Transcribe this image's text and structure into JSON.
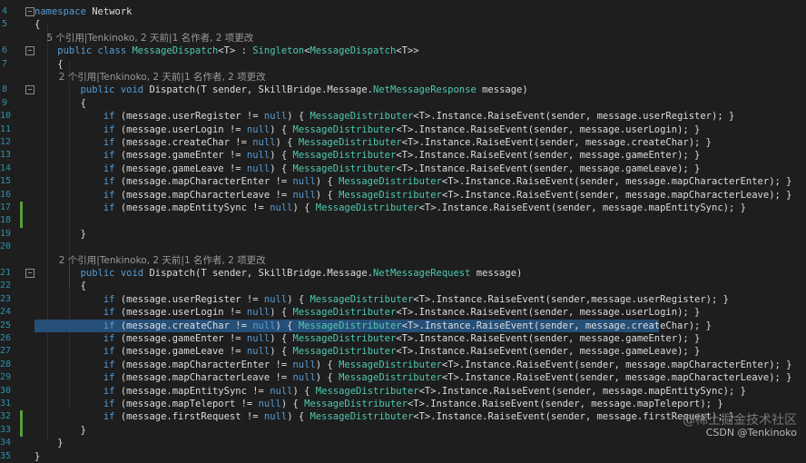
{
  "code": {
    "lines": [
      {
        "n": "4",
        "fold": "−",
        "parts": [
          {
            "c": "kw",
            "t": "namespace"
          },
          {
            "c": "pl",
            "t": " Network"
          }
        ]
      },
      {
        "n": "5",
        "parts": [
          {
            "c": "pl",
            "t": "{"
          }
        ]
      },
      {
        "n": "",
        "lens": true,
        "parts": [
          {
            "c": "lens",
            "t": "    5 个引用|Tenkinoko, 2 天前|1 名作者, 2 项更改"
          }
        ]
      },
      {
        "n": "6",
        "fold": "−",
        "parts": [
          {
            "c": "kw",
            "t": "    public class "
          },
          {
            "c": "ty",
            "t": "MessageDispatch"
          },
          {
            "c": "pl",
            "t": "<T> : "
          },
          {
            "c": "ty",
            "t": "Singleton"
          },
          {
            "c": "pl",
            "t": "<"
          },
          {
            "c": "ty",
            "t": "MessageDispatch"
          },
          {
            "c": "pl",
            "t": "<T>>"
          }
        ]
      },
      {
        "n": "7",
        "parts": [
          {
            "c": "pl",
            "t": "    {"
          }
        ]
      },
      {
        "n": "",
        "lens": true,
        "parts": [
          {
            "c": "lens",
            "t": "        2 个引用|Tenkinoko, 2 天前|1 名作者, 2 项更改"
          }
        ]
      },
      {
        "n": "8",
        "fold": "−",
        "parts": [
          {
            "c": "kw",
            "t": "        public void "
          },
          {
            "c": "pl",
            "t": "Dispatch(T sender, SkillBridge.Message."
          },
          {
            "c": "ty",
            "t": "NetMessageResponse"
          },
          {
            "c": "pl",
            "t": " message)"
          }
        ]
      },
      {
        "n": "9",
        "parts": [
          {
            "c": "pl",
            "t": "        {"
          }
        ]
      },
      {
        "n": "10",
        "parts": [
          {
            "c": "kw",
            "t": "            if"
          },
          {
            "c": "pl",
            "t": " (message.userRegister != "
          },
          {
            "c": "kw",
            "t": "null"
          },
          {
            "c": "pl",
            "t": ") { "
          },
          {
            "c": "ty",
            "t": "MessageDistributer"
          },
          {
            "c": "pl",
            "t": "<T>.Instance.RaiseEvent(sender, message.userRegister); }"
          }
        ]
      },
      {
        "n": "11",
        "parts": [
          {
            "c": "kw",
            "t": "            if"
          },
          {
            "c": "pl",
            "t": " (message.userLogin != "
          },
          {
            "c": "kw",
            "t": "null"
          },
          {
            "c": "pl",
            "t": ") { "
          },
          {
            "c": "ty",
            "t": "MessageDistributer"
          },
          {
            "c": "pl",
            "t": "<T>.Instance.RaiseEvent(sender, message.userLogin); }"
          }
        ]
      },
      {
        "n": "12",
        "parts": [
          {
            "c": "kw",
            "t": "            if"
          },
          {
            "c": "pl",
            "t": " (message.createChar != "
          },
          {
            "c": "kw",
            "t": "null"
          },
          {
            "c": "pl",
            "t": ") { "
          },
          {
            "c": "ty",
            "t": "MessageDistributer"
          },
          {
            "c": "pl",
            "t": "<T>.Instance.RaiseEvent(sender, message.createChar); }"
          }
        ]
      },
      {
        "n": "13",
        "parts": [
          {
            "c": "kw",
            "t": "            if"
          },
          {
            "c": "pl",
            "t": " (message.gameEnter != "
          },
          {
            "c": "kw",
            "t": "null"
          },
          {
            "c": "pl",
            "t": ") { "
          },
          {
            "c": "ty",
            "t": "MessageDistributer"
          },
          {
            "c": "pl",
            "t": "<T>.Instance.RaiseEvent(sender, message.gameEnter); }"
          }
        ]
      },
      {
        "n": "14",
        "parts": [
          {
            "c": "kw",
            "t": "            if"
          },
          {
            "c": "pl",
            "t": " (message.gameLeave != "
          },
          {
            "c": "kw",
            "t": "null"
          },
          {
            "c": "pl",
            "t": ") { "
          },
          {
            "c": "ty",
            "t": "MessageDistributer"
          },
          {
            "c": "pl",
            "t": "<T>.Instance.RaiseEvent(sender, message.gameLeave); }"
          }
        ]
      },
      {
        "n": "15",
        "parts": [
          {
            "c": "kw",
            "t": "            if"
          },
          {
            "c": "pl",
            "t": " (message.mapCharacterEnter != "
          },
          {
            "c": "kw",
            "t": "null"
          },
          {
            "c": "pl",
            "t": ") { "
          },
          {
            "c": "ty",
            "t": "MessageDistributer"
          },
          {
            "c": "pl",
            "t": "<T>.Instance.RaiseEvent(sender, message.mapCharacterEnter); }"
          }
        ]
      },
      {
        "n": "16",
        "parts": [
          {
            "c": "kw",
            "t": "            if"
          },
          {
            "c": "pl",
            "t": " (message.mapCharacterLeave != "
          },
          {
            "c": "kw",
            "t": "null"
          },
          {
            "c": "pl",
            "t": ") { "
          },
          {
            "c": "ty",
            "t": "MessageDistributer"
          },
          {
            "c": "pl",
            "t": "<T>.Instance.RaiseEvent(sender, message.mapCharacterLeave); }"
          }
        ]
      },
      {
        "n": "17",
        "chg": true,
        "parts": [
          {
            "c": "kw",
            "t": "            if"
          },
          {
            "c": "pl",
            "t": " (message.mapEntitySync != "
          },
          {
            "c": "kw",
            "t": "null"
          },
          {
            "c": "pl",
            "t": ") { "
          },
          {
            "c": "ty",
            "t": "MessageDistributer"
          },
          {
            "c": "pl",
            "t": "<T>.Instance.RaiseEvent(sender, message.mapEntitySync); }"
          }
        ]
      },
      {
        "n": "18",
        "chg": true,
        "parts": [
          {
            "c": "pl",
            "t": ""
          }
        ]
      },
      {
        "n": "19",
        "parts": [
          {
            "c": "pl",
            "t": "        }"
          }
        ]
      },
      {
        "n": "20",
        "parts": [
          {
            "c": "pl",
            "t": ""
          }
        ]
      },
      {
        "n": "",
        "lens": true,
        "parts": [
          {
            "c": "lens",
            "t": "        2 个引用|Tenkinoko, 2 天前|1 名作者, 2 项更改"
          }
        ]
      },
      {
        "n": "21",
        "fold": "−",
        "parts": [
          {
            "c": "kw",
            "t": "        public void "
          },
          {
            "c": "pl",
            "t": "Dispatch(T sender, SkillBridge.Message."
          },
          {
            "c": "ty",
            "t": "NetMessageRequest"
          },
          {
            "c": "pl",
            "t": " message)"
          }
        ]
      },
      {
        "n": "22",
        "parts": [
          {
            "c": "pl",
            "t": "        {"
          }
        ]
      },
      {
        "n": "23",
        "parts": [
          {
            "c": "kw",
            "t": "            if"
          },
          {
            "c": "pl",
            "t": " (message.userRegister != "
          },
          {
            "c": "kw",
            "t": "null"
          },
          {
            "c": "pl",
            "t": ") { "
          },
          {
            "c": "ty",
            "t": "MessageDistributer"
          },
          {
            "c": "pl",
            "t": "<T>.Instance.RaiseEvent(sender,message.userRegister); }"
          }
        ]
      },
      {
        "n": "24",
        "parts": [
          {
            "c": "kw",
            "t": "            if"
          },
          {
            "c": "pl",
            "t": " (message.userLogin != "
          },
          {
            "c": "kw",
            "t": "null"
          },
          {
            "c": "pl",
            "t": ") { "
          },
          {
            "c": "ty",
            "t": "MessageDistributer"
          },
          {
            "c": "pl",
            "t": "<T>.Instance.RaiseEvent(sender, message.userLogin); }"
          }
        ]
      },
      {
        "n": "25",
        "sel": true,
        "parts": [
          {
            "c": "kw",
            "t": "            if"
          },
          {
            "c": "pl",
            "t": " (message.createChar != "
          },
          {
            "c": "kw",
            "t": "null"
          },
          {
            "c": "pl",
            "t": ") { "
          },
          {
            "c": "ty",
            "t": "MessageDistributer"
          },
          {
            "c": "pl",
            "t": "<T>.Instance.RaiseEvent(sender, message.createChar); }"
          }
        ]
      },
      {
        "n": "26",
        "parts": [
          {
            "c": "kw",
            "t": "            if"
          },
          {
            "c": "pl",
            "t": " (message.gameEnter != "
          },
          {
            "c": "kw",
            "t": "null"
          },
          {
            "c": "pl",
            "t": ") { "
          },
          {
            "c": "ty",
            "t": "MessageDistributer"
          },
          {
            "c": "pl",
            "t": "<T>.Instance.RaiseEvent(sender, message.gameEnter); }"
          }
        ]
      },
      {
        "n": "27",
        "parts": [
          {
            "c": "kw",
            "t": "            if"
          },
          {
            "c": "pl",
            "t": " (message.gameLeave != "
          },
          {
            "c": "kw",
            "t": "null"
          },
          {
            "c": "pl",
            "t": ") { "
          },
          {
            "c": "ty",
            "t": "MessageDistributer"
          },
          {
            "c": "pl",
            "t": "<T>.Instance.RaiseEvent(sender, message.gameLeave); }"
          }
        ]
      },
      {
        "n": "28",
        "parts": [
          {
            "c": "kw",
            "t": "            if"
          },
          {
            "c": "pl",
            "t": " (message.mapCharacterEnter != "
          },
          {
            "c": "kw",
            "t": "null"
          },
          {
            "c": "pl",
            "t": ") { "
          },
          {
            "c": "ty",
            "t": "MessageDistributer"
          },
          {
            "c": "pl",
            "t": "<T>.Instance.RaiseEvent(sender, message.mapCharacterEnter); }"
          }
        ]
      },
      {
        "n": "29",
        "parts": [
          {
            "c": "kw",
            "t": "            if"
          },
          {
            "c": "pl",
            "t": " (message.mapCharacterLeave != "
          },
          {
            "c": "kw",
            "t": "null"
          },
          {
            "c": "pl",
            "t": ") { "
          },
          {
            "c": "ty",
            "t": "MessageDistributer"
          },
          {
            "c": "pl",
            "t": "<T>.Instance.RaiseEvent(sender, message.mapCharacterLeave); }"
          }
        ]
      },
      {
        "n": "30",
        "parts": [
          {
            "c": "kw",
            "t": "            if"
          },
          {
            "c": "pl",
            "t": " (message.mapEntitySync != "
          },
          {
            "c": "kw",
            "t": "null"
          },
          {
            "c": "pl",
            "t": ") { "
          },
          {
            "c": "ty",
            "t": "MessageDistributer"
          },
          {
            "c": "pl",
            "t": "<T>.Instance.RaiseEvent(sender, message.mapEntitySync); }"
          }
        ]
      },
      {
        "n": "31",
        "parts": [
          {
            "c": "kw",
            "t": "            if"
          },
          {
            "c": "pl",
            "t": " (message.mapTeleport != "
          },
          {
            "c": "kw",
            "t": "null"
          },
          {
            "c": "pl",
            "t": ") { "
          },
          {
            "c": "ty",
            "t": "MessageDistributer"
          },
          {
            "c": "pl",
            "t": "<T>.Instance.RaiseEvent(sender, message.mapTeleport); }"
          }
        ]
      },
      {
        "n": "32",
        "chg": true,
        "parts": [
          {
            "c": "kw",
            "t": "            if"
          },
          {
            "c": "pl",
            "t": " (message.firstRequest != "
          },
          {
            "c": "kw",
            "t": "null"
          },
          {
            "c": "pl",
            "t": ") { "
          },
          {
            "c": "ty",
            "t": "MessageDistributer"
          },
          {
            "c": "pl",
            "t": "<T>.Instance.RaiseEvent(sender, message.firstRequest); }"
          }
        ]
      },
      {
        "n": "33",
        "chg": true,
        "parts": [
          {
            "c": "pl",
            "t": "        }"
          }
        ]
      },
      {
        "n": "34",
        "parts": [
          {
            "c": "pl",
            "t": "    }"
          }
        ]
      },
      {
        "n": "35",
        "parts": [
          {
            "c": "pl",
            "t": "}"
          }
        ]
      }
    ]
  },
  "watermark": {
    "line1": "@稀土掘金技术社区",
    "line2": "CSDN @Tenkinoko"
  },
  "colors": {
    "background": "#1e1e1e",
    "keyword": "#569cd6",
    "type": "#4ec9b0",
    "text": "#dcdcdc",
    "codelens": "#999999",
    "line_number": "#2b91af",
    "selection": "#264f78",
    "change_bar": "#5a9e3a"
  }
}
